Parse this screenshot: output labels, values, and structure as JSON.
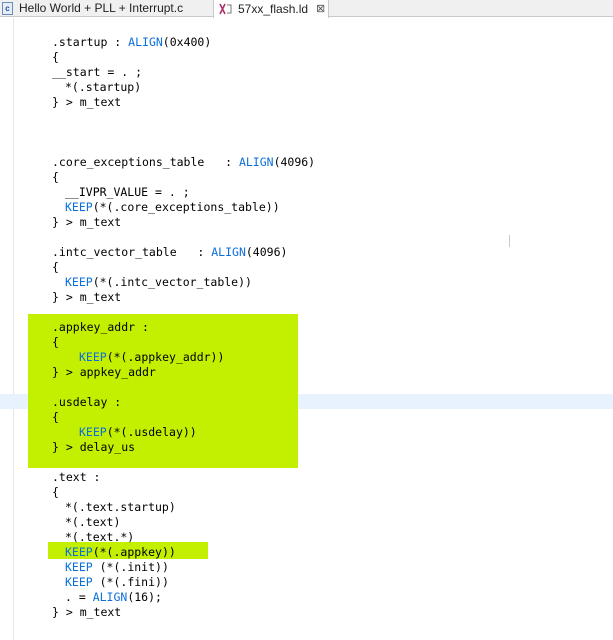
{
  "tabs": [
    {
      "label": "Hello World + PLL + Interrupt.c",
      "icon": "c-file-icon",
      "active": false
    },
    {
      "label": "57xx_flash.ld",
      "icon": "linker-file-icon",
      "active": true,
      "close": "⊠"
    }
  ],
  "colors": {
    "keyword": "#0b6fdd",
    "highlight": "#c2f000",
    "cursor_line": "#e8f2fe"
  },
  "code": {
    "startup_decl": ".startup : ",
    "startup_align_kw": "ALIGN",
    "startup_align_arg": "(0x400)",
    "startup_open": "{",
    "startup_start": "__start = . ;",
    "startup_input": "*(.startup)",
    "startup_close": "} > m_text",
    "core_decl": ".core_exceptions_table   : ",
    "core_align_kw": "ALIGN",
    "core_align_arg": "(4096)",
    "core_open": "{",
    "core_ivpr": "__IVPR_VALUE = . ;",
    "core_keep_kw": "KEEP",
    "core_keep_arg": "(*(.core_exceptions_table))",
    "core_close": "} > m_text",
    "intc_decl": ".intc_vector_table   : ",
    "intc_align_kw": "ALIGN",
    "intc_align_arg": "(4096)",
    "intc_open": "{",
    "intc_keep_kw": "KEEP",
    "intc_keep_arg": "(*(.intc_vector_table))",
    "intc_close": "} > m_text",
    "appkey_decl": ".appkey_addr :",
    "appkey_open": "{",
    "appkey_keep_kw": "KEEP",
    "appkey_keep_arg": "(*(.appkey_addr))",
    "appkey_close": "} > appkey_addr",
    "usdelay_decl": ".usdelay :",
    "usdelay_open": "{",
    "usdelay_keep_kw": "KEEP",
    "usdelay_keep_arg": "(*(.usdelay))",
    "usdelay_close": "} > delay_us",
    "text_decl": ".text :",
    "text_open": "{",
    "text_startup": "*(.text.startup)",
    "text_text": "*(.text)",
    "text_text_all": "*(.text.*)",
    "text_keep_appkey_kw": "KEEP",
    "text_keep_appkey_arg": "(*(.appkey))",
    "text_keep_init_kw": "KEEP",
    "text_keep_init_arg": " (*(.init))",
    "text_keep_fini_kw": "KEEP",
    "text_keep_fini_arg": " (*(.fini))",
    "text_align_pre": ". = ",
    "text_align_kw": "ALIGN",
    "text_align_arg": "(16);",
    "text_close": "} > m_text"
  }
}
